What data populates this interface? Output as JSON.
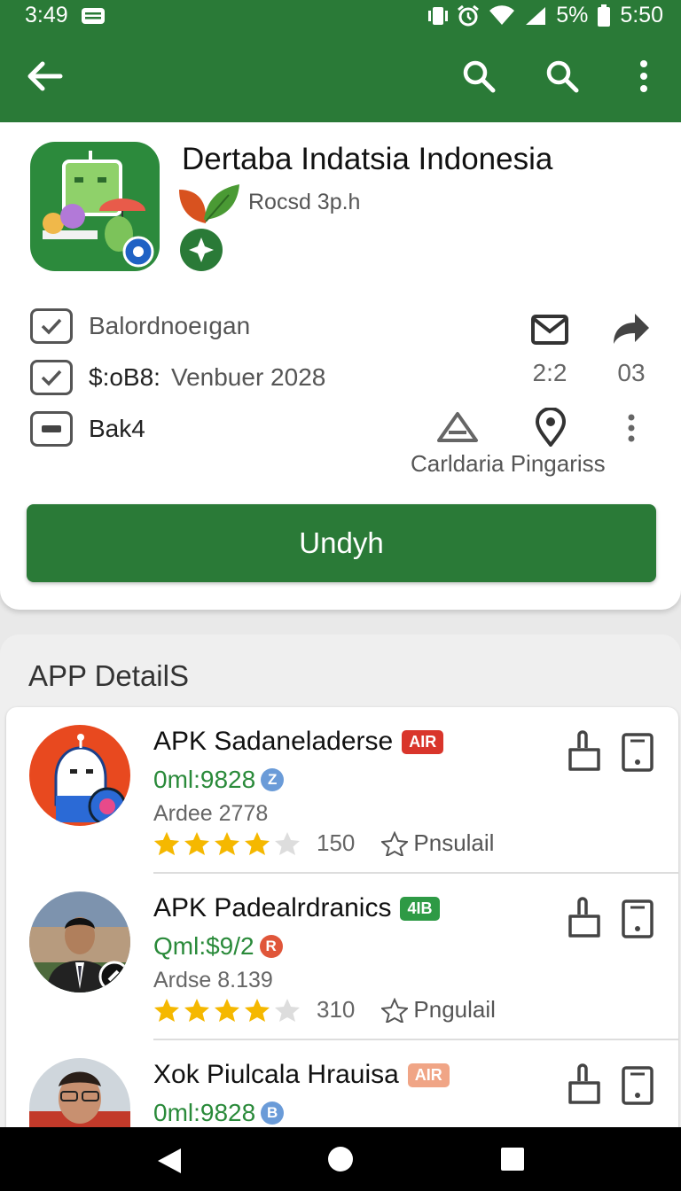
{
  "status_bar": {
    "time_left": "3:49",
    "battery": "5%",
    "time_right": "5:50"
  },
  "app": {
    "title": "Dertaba Indatsia Indonesia",
    "developer": "Rocsd 3p.h",
    "meta": [
      {
        "label": "Balordnoeıgan"
      },
      {
        "prefix": "$:oB8:",
        "label": "Venbuer 2028"
      },
      {
        "label": "Bak4"
      }
    ],
    "actions": {
      "mail_count": "2:2",
      "share_count": "03"
    },
    "location_label": "Carldaria Pingariss",
    "install_label": "Undyh"
  },
  "details": {
    "title": "APP DetailS",
    "items": [
      {
        "name": "APK Sadaneladerse",
        "tag": "AIR",
        "tag_color": "#d9352b",
        "price": "0ml:9828",
        "coin": "Z",
        "coin_color": "#6a9bd8",
        "sub": "Ardee 2778",
        "stars": 4,
        "count": "150",
        "follow": "Pnsulail"
      },
      {
        "name": "APK Padealrdranics",
        "tag": "4IB",
        "tag_color": "#2e9a45",
        "price": "Qml:$9/2",
        "coin": "R",
        "coin_color": "#e0563a",
        "sub": "Ardse 8.139",
        "stars": 4,
        "count": "310",
        "follow": "Pngulail"
      },
      {
        "name": "Xok Piulcala Hrauisa",
        "tag": "AIR",
        "tag_color": "#f0a586",
        "price": "0ml:9828",
        "coin": "B",
        "coin_color": "#6a9bd8"
      }
    ]
  },
  "colors": {
    "primary": "#2a7a37",
    "accent_star": "#f5b800"
  }
}
